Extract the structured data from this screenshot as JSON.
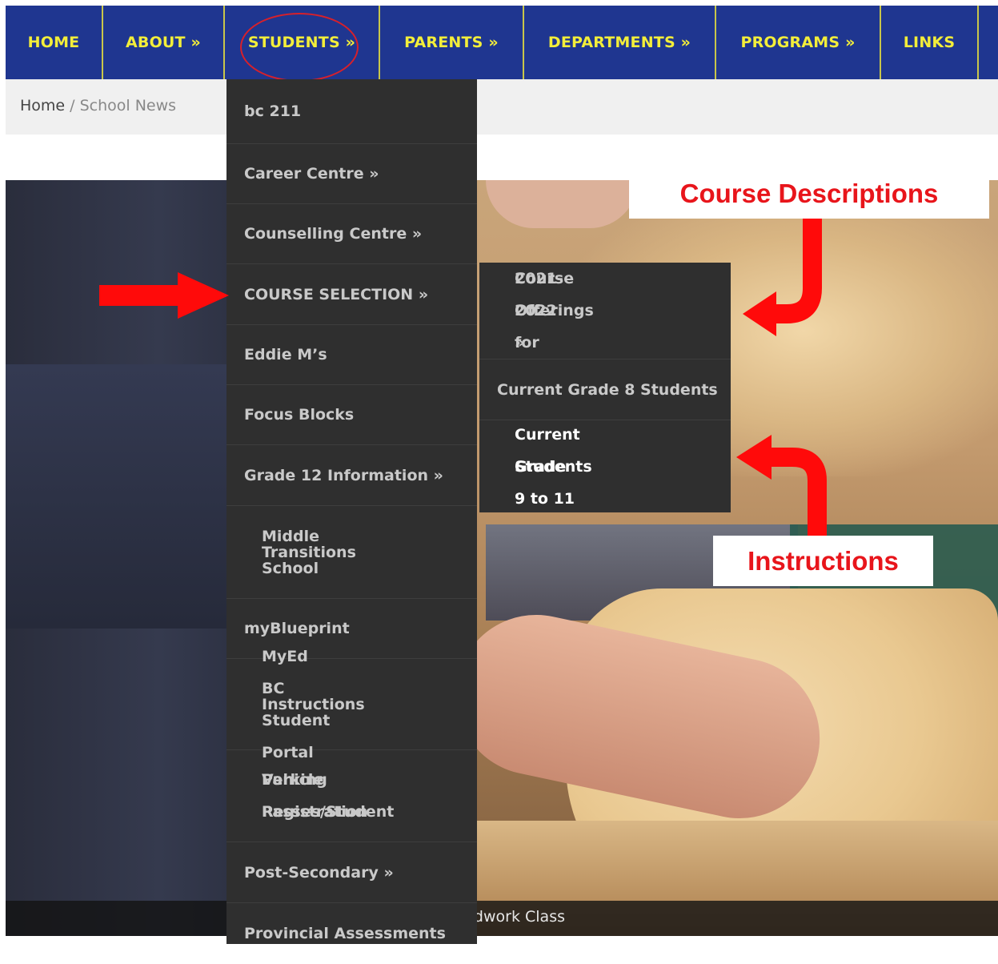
{
  "nav": {
    "items": [
      "HOME",
      "ABOUT »",
      "STUDENTS »",
      "PARENTS »",
      "DEPARTMENTS »",
      "PROGRAMS »",
      "LINKS"
    ]
  },
  "breadcrumb": {
    "home": "Home",
    "separator": " / ",
    "current": "School News"
  },
  "students_menu": [
    "bc 211",
    "Career Centre »",
    "Counselling Centre »",
    "COURSE SELECTION »",
    "Eddie M’s",
    "Focus Blocks",
    "Grade 12 Information »",
    [
      "Middle School",
      "Transitions"
    ],
    "myBlueprint",
    [
      "MyEd BC Student Portal",
      "Instructions"
    ],
    [
      "Parking Passes/Student",
      "Vehicle Registration"
    ],
    "Post-Secondary »",
    "Provincial Assessments"
  ],
  "course_selection_menu": [
    [
      "Course Offerings for",
      "2021-2022 »"
    ],
    "Current Grade 8 Students",
    [
      "Current Grade 9 to 11",
      "Students"
    ]
  ],
  "hero": {
    "caption": "Woodwork Class"
  },
  "annotations": {
    "course_descriptions": "Course Descriptions",
    "instructions": "Instructions"
  },
  "colors": {
    "nav_bg": "#1f3690",
    "nav_text": "#f3ee3a",
    "menu_bg": "#2f2f2f",
    "annotation_red": "#e8151b"
  }
}
